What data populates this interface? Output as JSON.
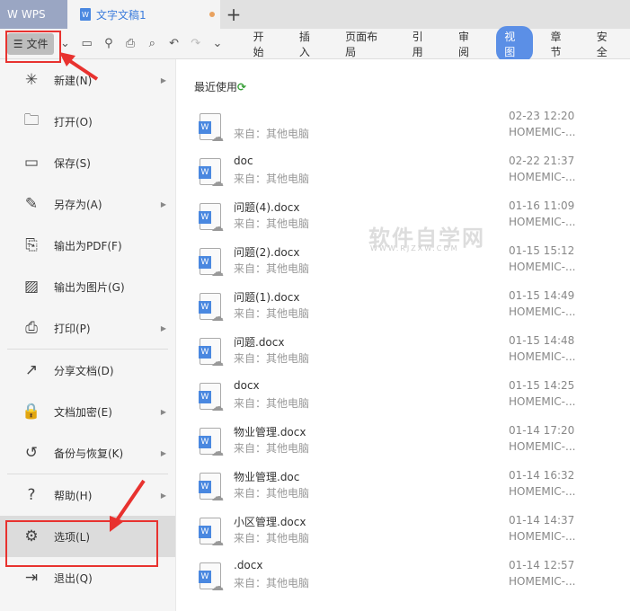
{
  "titlebar": {
    "app": "WPS",
    "doc_tab": "文字文稿1",
    "new_tab": "+"
  },
  "toolbar": {
    "file": "文件",
    "ribbon": [
      "开始",
      "插入",
      "页面布局",
      "引用",
      "审阅",
      "视图",
      "章节",
      "安全"
    ],
    "active_tab": "视图"
  },
  "menu": [
    {
      "label": "新建(N)",
      "icon": "new-icon",
      "glyph": "✳",
      "arrow": true
    },
    {
      "label": "打开(O)",
      "icon": "folder-icon",
      "glyph": "🗀",
      "arrow": false
    },
    {
      "label": "保存(S)",
      "icon": "save-icon",
      "glyph": "▭",
      "arrow": false
    },
    {
      "label": "另存为(A)",
      "icon": "save-as-icon",
      "glyph": "✎",
      "arrow": true
    },
    {
      "label": "输出为PDF(F)",
      "icon": "pdf-icon",
      "glyph": "⎘",
      "arrow": false
    },
    {
      "label": "输出为图片(G)",
      "icon": "image-icon",
      "glyph": "▨",
      "arrow": false
    },
    {
      "label": "打印(P)",
      "icon": "print-icon",
      "glyph": "⎙",
      "arrow": true
    },
    {
      "label": "分享文档(D)",
      "icon": "share-icon",
      "glyph": "↗",
      "arrow": false
    },
    {
      "label": "文档加密(E)",
      "icon": "encrypt-icon",
      "glyph": "🔒",
      "arrow": true
    },
    {
      "label": "备份与恢复(K)",
      "icon": "backup-icon",
      "glyph": "↺",
      "arrow": true
    },
    {
      "label": "帮助(H)",
      "icon": "help-icon",
      "glyph": "?",
      "arrow": true
    },
    {
      "label": "选项(L)",
      "icon": "gear-icon",
      "glyph": "⚙",
      "arrow": false
    },
    {
      "label": "退出(Q)",
      "icon": "exit-icon",
      "glyph": "⇥",
      "arrow": false
    }
  ],
  "recent": {
    "title": "最近使用",
    "files": [
      {
        "name": "",
        "source": "来自：其他电脑",
        "date": "02-23 12:20",
        "device": "HOMEMIC-..."
      },
      {
        "name": "doc",
        "source": "来自：其他电脑",
        "date": "02-22 21:37",
        "device": "HOMEMIC-..."
      },
      {
        "name": "问题(4).docx",
        "source": "来自：其他电脑",
        "date": "01-16 11:09",
        "device": "HOMEMIC-..."
      },
      {
        "name": "问题(2).docx",
        "source": "来自：其他电脑",
        "date": "01-15 15:12",
        "device": "HOMEMIC-..."
      },
      {
        "name": "问题(1).docx",
        "source": "来自：其他电脑",
        "date": "01-15 14:49",
        "device": "HOMEMIC-..."
      },
      {
        "name": "问题.docx",
        "source": "来自：其他电脑",
        "date": "01-15 14:48",
        "device": "HOMEMIC-..."
      },
      {
        "name": "docx",
        "source": "来自：其他电脑",
        "date": "01-15 14:25",
        "device": "HOMEMIC-..."
      },
      {
        "name": "物业管理.docx",
        "source": "来自：其他电脑",
        "date": "01-14 17:20",
        "device": "HOMEMIC-..."
      },
      {
        "name": "物业管理.doc",
        "source": "来自：其他电脑",
        "date": "01-14 16:32",
        "device": "HOMEMIC-..."
      },
      {
        "name": "小区管理.docx",
        "source": "来自：其他电脑",
        "date": "01-14 14:37",
        "device": "HOMEMIC-..."
      },
      {
        "name": ".docx",
        "source": "来自：其他电脑",
        "date": "01-14 12:57",
        "device": "HOMEMIC-..."
      }
    ]
  },
  "watermark": {
    "text": "软件自学网",
    "url": "WWW.RJZXW.COM"
  }
}
